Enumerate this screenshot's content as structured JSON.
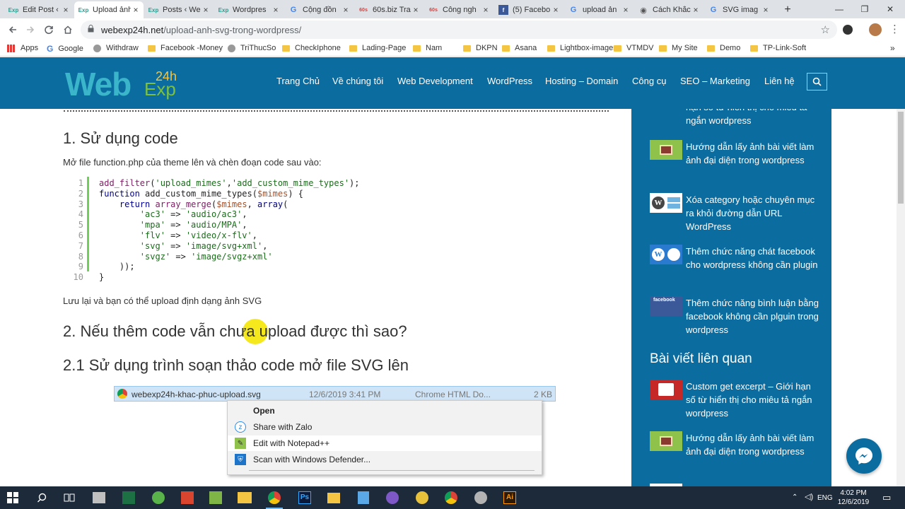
{
  "browser": {
    "tabs": [
      {
        "label": "Edit Post ‹",
        "favicon": "Exp",
        "active": false
      },
      {
        "label": "Upload ảnh",
        "favicon": "Exp",
        "active": true
      },
      {
        "label": "Posts ‹ We",
        "favicon": "Exp",
        "active": false
      },
      {
        "label": "Wordpres",
        "favicon": "Exp",
        "active": false
      },
      {
        "label": "Cộng đồn",
        "favicon": "G",
        "active": false
      },
      {
        "label": "60s.biz Tra",
        "favicon": "60s",
        "active": false
      },
      {
        "label": "Công ngh",
        "favicon": "60s",
        "active": false
      },
      {
        "label": "(5) Facebo",
        "favicon": "f",
        "active": false
      },
      {
        "label": "upload ản",
        "favicon": "G",
        "active": false
      },
      {
        "label": "Cách Khắc",
        "favicon": "◉",
        "active": false
      },
      {
        "label": "SVG imag",
        "favicon": "G",
        "active": false
      }
    ],
    "new_tab_symbol": "+",
    "window_controls": {
      "minimize": "—",
      "maximize": "❐",
      "close": "✕"
    },
    "url_domain": "webexp24h.net",
    "url_path": "/upload-anh-svg-trong-wordpress/",
    "bookmarks": [
      {
        "label": "Apps",
        "type": "apps"
      },
      {
        "label": "Google",
        "type": "google"
      },
      {
        "label": "Withdraw",
        "type": "page"
      },
      {
        "label": "Facebook -Money",
        "type": "folder"
      },
      {
        "label": "TriThucSo",
        "type": "page"
      },
      {
        "label": "CheckIphone",
        "type": "folder"
      },
      {
        "label": "Lading-Page",
        "type": "folder"
      },
      {
        "label": "Nam",
        "type": "folder"
      },
      {
        "label": "DKPN",
        "type": "folder"
      },
      {
        "label": "Asana",
        "type": "folder"
      },
      {
        "label": "Lightbox-images",
        "type": "folder"
      },
      {
        "label": "VTMDV",
        "type": "folder"
      },
      {
        "label": "My Site",
        "type": "folder"
      },
      {
        "label": "Demo",
        "type": "folder"
      },
      {
        "label": "TP-Link-Soft",
        "type": "folder"
      }
    ],
    "bookmarks_overflow": "»"
  },
  "site": {
    "logo_main": "Web",
    "logo_num": "24h",
    "logo_sub": "Exp",
    "menu": [
      "Trang Chủ",
      "Về chúng tôi",
      "Web Development",
      "WordPress",
      "Hosting – Domain",
      "Công cụ",
      "SEO – Marketing",
      "Liên hệ"
    ],
    "brand_color": "#0b6ca0"
  },
  "article": {
    "heading1": "1. Sử dụng code",
    "intro": "Mở file function.php của theme lên và chèn đoạn code sau vào:",
    "code_line_numbers": [
      "1",
      "2",
      "3",
      "4",
      "5",
      "6",
      "7",
      "8",
      "9",
      "10"
    ],
    "after_code": "Lưu lại và bạn có thể upload định dạng ảnh SVG",
    "heading2": "2. Nếu thêm code vẫn chưa upload được thì sao?",
    "heading3": "2.1 Sử dụng trình soạn thảo code mở file SVG lên"
  },
  "explorer": {
    "file_name": "webexp24h-khac-phuc-upload.svg",
    "file_date": "12/6/2019 3:41 PM",
    "file_type": "Chrome HTML Do...",
    "file_size": "2 KB",
    "context_menu": [
      "Open",
      "Share with Zalo",
      "Edit with Notepad++",
      "Scan with Windows Defender..."
    ]
  },
  "sidebar": {
    "top_partial": "hạn số từ hiển thị cho miêu tả ngắn wordpress",
    "recent_posts": [
      "Hướng dẫn lấy ảnh bài viết làm ảnh đại diện trong wordpress",
      "Xóa category hoặc chuyên mục ra khỏi đường dẫn URL WordPress",
      "Thêm chức năng chát facebook cho wordpress không cần plugin",
      "Thêm chức năng bình luận bằng facebook không cần plguin trong wordpress"
    ],
    "related_title": "Bài viết liên quan",
    "related_posts": [
      "Custom get excerpt – Giới hạn số từ hiển thị cho miêu tả ngắn wordpress",
      "Hướng dẫn lấy ảnh bài viết làm ảnh đại diện trong wordpress"
    ],
    "thumb_fb_label": "facebook"
  },
  "taskbar": {
    "icons": [
      "windows-start",
      "search",
      "task-view",
      "app-store",
      "excel",
      "green-app",
      "red-app",
      "tools-app",
      "file-explorer",
      "chrome",
      "photoshop",
      "folder",
      "notepad",
      "viber",
      "paint",
      "chrome-2",
      "filezilla",
      "illustrator"
    ],
    "ps_label": "Ps",
    "ai_label": "Ai",
    "language": "ENG",
    "time": "4:02 PM",
    "date": "12/6/2019"
  }
}
